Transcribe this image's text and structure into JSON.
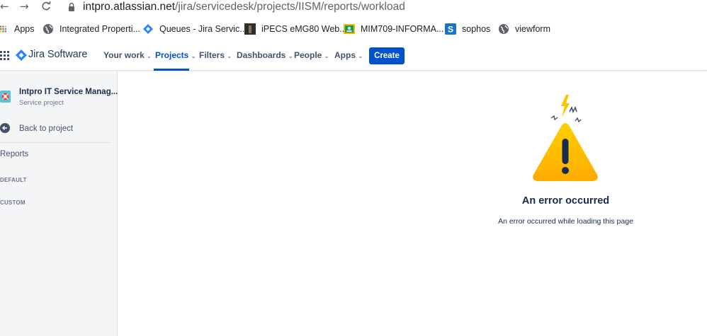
{
  "browser": {
    "url_host": "intpro.atlassian.net",
    "url_path": "/jira/servicedesk/projects/IISM/reports/workload"
  },
  "bookmarks": [
    {
      "label": "Apps",
      "icon": "apps-grid-icon"
    },
    {
      "label": "Integrated Properti...",
      "icon": "globe-icon"
    },
    {
      "label": "Queues - Jira Servic...",
      "icon": "jira-icon"
    },
    {
      "label": "iPECS eMG80 Web...",
      "icon": "ipecs-icon"
    },
    {
      "label": "MIM709-INFORMA...",
      "icon": "classroom-icon"
    },
    {
      "label": "sophos",
      "icon": "sophos-icon"
    },
    {
      "label": "viewform",
      "icon": "globe-icon"
    }
  ],
  "jira_nav": {
    "logo": "Jira Software",
    "menu": [
      {
        "label": "Your work"
      },
      {
        "label": "Projects"
      },
      {
        "label": "Filters"
      },
      {
        "label": "Dashboards"
      },
      {
        "label": "People"
      },
      {
        "label": "Apps"
      }
    ],
    "active": "Projects",
    "create_label": "Create",
    "accent": "#0052cc"
  },
  "sidebar": {
    "project_name": "Intpro IT Service Manag...",
    "project_type": "Service project",
    "back_label": "Back to project",
    "heading": "Reports",
    "groups": [
      "DEFAULT",
      "CUSTOM"
    ]
  },
  "error": {
    "title": "An error occurred",
    "message": "An error occurred while loading this page",
    "icon": "warning-icon"
  }
}
